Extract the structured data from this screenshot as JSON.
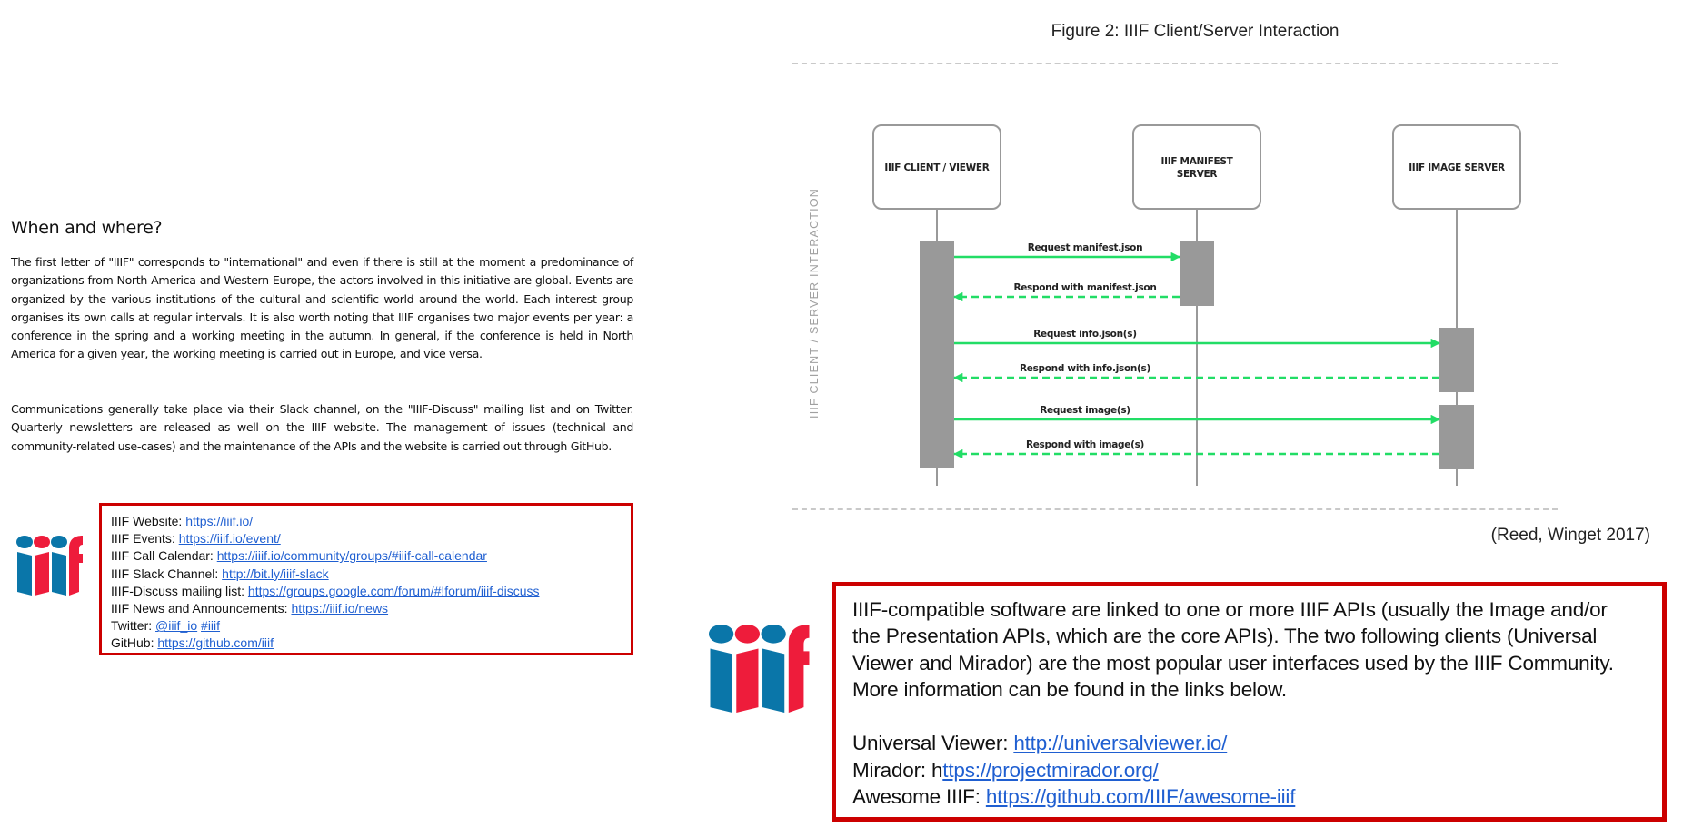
{
  "left": {
    "section_title": "When and where?",
    "paragraphs": [
      "The first letter of \"IIIF\" corresponds to \"international\" and even if there is still at the moment a predominance of organizations from North America and Western Europe, the actors involved in this initiative are global. Events are organized by the various institutions of the cultural and scientific world around the world. Each interest group organises its own calls at regular intervals. It is also worth noting that IIIF organises two major events per year: a conference in the spring and a working meeting in the autumn. In general, if the conference is held in North America for a given year, the working meeting is carried out in Europe, and vice versa.",
      "Communications generally take place via their Slack channel, on the \"IIIF-Discuss\" mailing list and on Twitter. Quarterly newsletters are released as well on the IIIF website. The management of issues (technical and community-related use-cases) and the maintenance of the APIs and the website is carried out through GitHub."
    ],
    "logo_icon": "iiif-logo-icon",
    "links": [
      {
        "label": "IIIF Website: ",
        "links": [
          "https://iiif.io/"
        ]
      },
      {
        "label": "IIIF Events: ",
        "links": [
          "https://iiif.io/event/"
        ]
      },
      {
        "label": "IIIF Call Calendar: ",
        "links": [
          "https://iiif.io/community/groups/#iiif-call-calendar"
        ]
      },
      {
        "label": "IIIF Slack Channel: ",
        "links": [
          "http://bit.ly/iiif-slack"
        ]
      },
      {
        "label": "IIIF-Discuss mailing list: ",
        "links": [
          "https://groups.google.com/forum/#!forum/iiif-discuss"
        ]
      },
      {
        "label": "IIIF News and Announcements: ",
        "links": [
          "https://iiif.io/news"
        ]
      },
      {
        "label": "Twitter: ",
        "links": [
          "@iiif_io",
          "#iiif"
        ]
      },
      {
        "label": "GitHub: ",
        "links": [
          "https://github.com/iiif"
        ]
      }
    ]
  },
  "figure": {
    "title": "Figure 2: IIIF Client/Server Interaction",
    "side_label": "IIIF CLIENT / SERVER INTERACTION",
    "actors": [
      {
        "lines": [
          "IIIF CLIENT / VIEWER"
        ]
      },
      {
        "lines": [
          "IIIF MANIFEST",
          "SERVER"
        ]
      },
      {
        "lines": [
          "IIIF IMAGE SERVER"
        ]
      }
    ],
    "messages": [
      {
        "label": "Request manifest.json",
        "from": 0,
        "to": 1,
        "kind": "request"
      },
      {
        "label": "Respond with manifest.json",
        "from": 1,
        "to": 0,
        "kind": "response"
      },
      {
        "label": "Request info.json(s)",
        "from": 0,
        "to": 2,
        "kind": "request"
      },
      {
        "label": "Respond with info.json(s)",
        "from": 2,
        "to": 0,
        "kind": "response"
      },
      {
        "label": "Request image(s)",
        "from": 0,
        "to": 2,
        "kind": "request"
      },
      {
        "label": "Respond with image(s)",
        "from": 2,
        "to": 0,
        "kind": "response"
      }
    ],
    "colors": {
      "arrow": "#22dd66",
      "activation": "#999999",
      "lifeline": "#999999",
      "box_border": "#999999"
    },
    "citation": "(Reed, Winget 2017)"
  },
  "info": {
    "logo_icon": "iiif-logo-icon",
    "text_lines": [
      "IIIF-compatible software are linked to one or more IIIF APIs (usually the Image and/or",
      "the Presentation APIs, which are the core APIs). The two following clients (Universal",
      "Viewer and Mirador) are the most popular user interfaces used by the IIIF Community.",
      "More information can be found in the links below."
    ],
    "links": [
      {
        "label": "Universal Viewer: ",
        "url": "http://universalviewer.io/"
      },
      {
        "label": "Mirador: h",
        "url": "ttps://projectmirador.org/"
      },
      {
        "label": "Awesome IIIF: ",
        "url": "https://github.com/IIIF/awesome-iiif"
      }
    ]
  },
  "colors": {
    "box_border": "#cc0000",
    "link": "#1f5fd1",
    "logo_blue": "#0a76a9",
    "logo_red": "#ee1c3b"
  }
}
